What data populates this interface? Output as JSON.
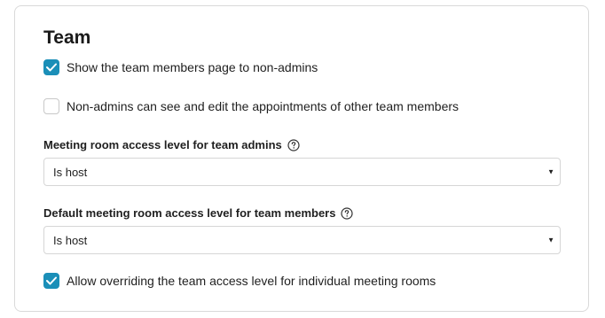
{
  "section": {
    "title": "Team"
  },
  "options": {
    "show_members_page": {
      "label": "Show the team members page to non-admins",
      "checked": true
    },
    "edit_others_appointments": {
      "label": "Non-admins can see and edit the appointments of other team members",
      "checked": false
    },
    "allow_override": {
      "label": "Allow overriding the team access level for individual meeting rooms",
      "checked": true
    }
  },
  "admin_access": {
    "label": "Meeting room access level for team admins",
    "value": "Is host"
  },
  "member_access": {
    "label": "Default meeting room access level for team members",
    "value": "Is host"
  },
  "colors": {
    "accent": "#1b8fb8",
    "border": "#d9d9d9"
  }
}
